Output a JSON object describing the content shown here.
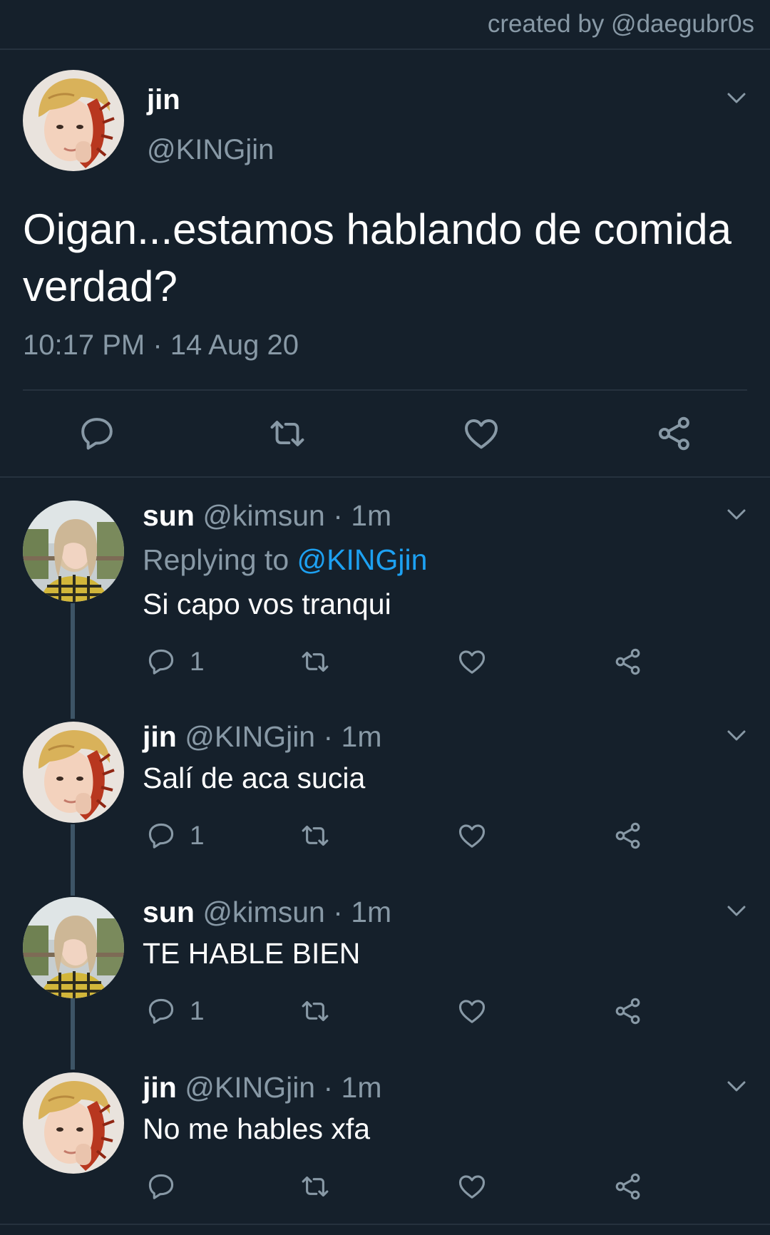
{
  "credit": "created by @daegubr0s",
  "colors": {
    "background": "#15202b",
    "secondary_text": "#8899a6",
    "link": "#1da1f2",
    "thread_line": "#3d5466"
  },
  "main_tweet": {
    "name": "jin",
    "handle": "@KINGjin",
    "text": "Oigan...estamos hablando de comida verdad?",
    "timestamp": "10:17 PM · 14 Aug 20",
    "avatar": "jin-avatar",
    "actions": [
      "reply-icon",
      "retweet-icon",
      "like-icon",
      "share-icon"
    ]
  },
  "replies": [
    {
      "name": "sun",
      "handle": "@kimsun · 1m",
      "replying_prefix": "Replying to ",
      "replying_mention": "@KINGjin",
      "text": "Si capo vos tranqui",
      "reply_count": "1",
      "avatar": "sun-avatar"
    },
    {
      "name": "jin",
      "handle": "@KINGjin · 1m",
      "text": "Salí de aca sucia",
      "reply_count": "1",
      "avatar": "jin-avatar"
    },
    {
      "name": "sun",
      "handle": "@kimsun · 1m",
      "text": "TE HABLE BIEN",
      "reply_count": "1",
      "avatar": "sun-avatar"
    },
    {
      "name": "jin",
      "handle": "@KINGjin · 1m",
      "text": "No me hables xfa",
      "reply_count": "",
      "avatar": "jin-avatar"
    }
  ]
}
